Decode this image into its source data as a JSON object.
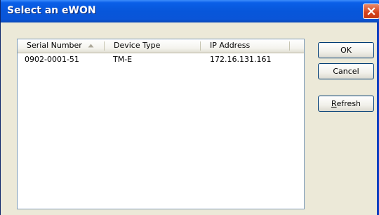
{
  "window": {
    "title": "Select an eWON"
  },
  "list": {
    "columns": [
      {
        "label": "Serial Number",
        "sorted": "ascending"
      },
      {
        "label": "Device Type"
      },
      {
        "label": "IP Address"
      }
    ],
    "rows": [
      {
        "serial": "0902-0001-51",
        "device_type": "TM-E",
        "ip": "172.16.131.161"
      }
    ]
  },
  "buttons": {
    "ok": "OK",
    "cancel": "Cancel",
    "refresh_mnemonic": "R",
    "refresh_rest": "efresh"
  },
  "colors": {
    "titlebar": "#0756da",
    "close_button": "#d5401a",
    "dialog_background": "#ece9d8"
  }
}
